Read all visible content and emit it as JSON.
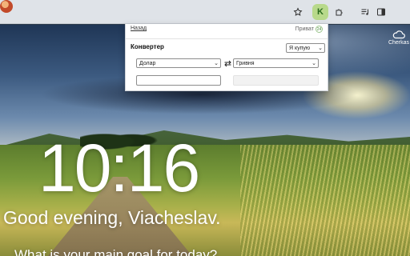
{
  "toolbar": {
    "extension_badge": "K",
    "icons": [
      "star-icon",
      "extension-k-icon",
      "puzzle-icon",
      "media-controls-icon",
      "side-panel-icon",
      "profile-avatar"
    ]
  },
  "popup": {
    "back_link": "Назад",
    "bank_name": "Приват",
    "bank_badge": "24",
    "title": "Конвертер",
    "mode_select": {
      "value": "Я купую"
    },
    "from_currency": {
      "value": "Долар"
    },
    "to_currency": {
      "value": "Гривня"
    },
    "amount_input": {
      "value": "",
      "placeholder": ""
    },
    "result_field": {
      "value": ""
    }
  },
  "weather": {
    "icon": "cloud-icon",
    "city": "Cherkas"
  },
  "main": {
    "time": "10:16",
    "greeting": "Good evening, Viacheslav.",
    "focus_prompt": "What is your main goal for today?"
  },
  "colors": {
    "extension_bg": "#b8d98b",
    "toolbar_bg": "#dfe3e8"
  }
}
